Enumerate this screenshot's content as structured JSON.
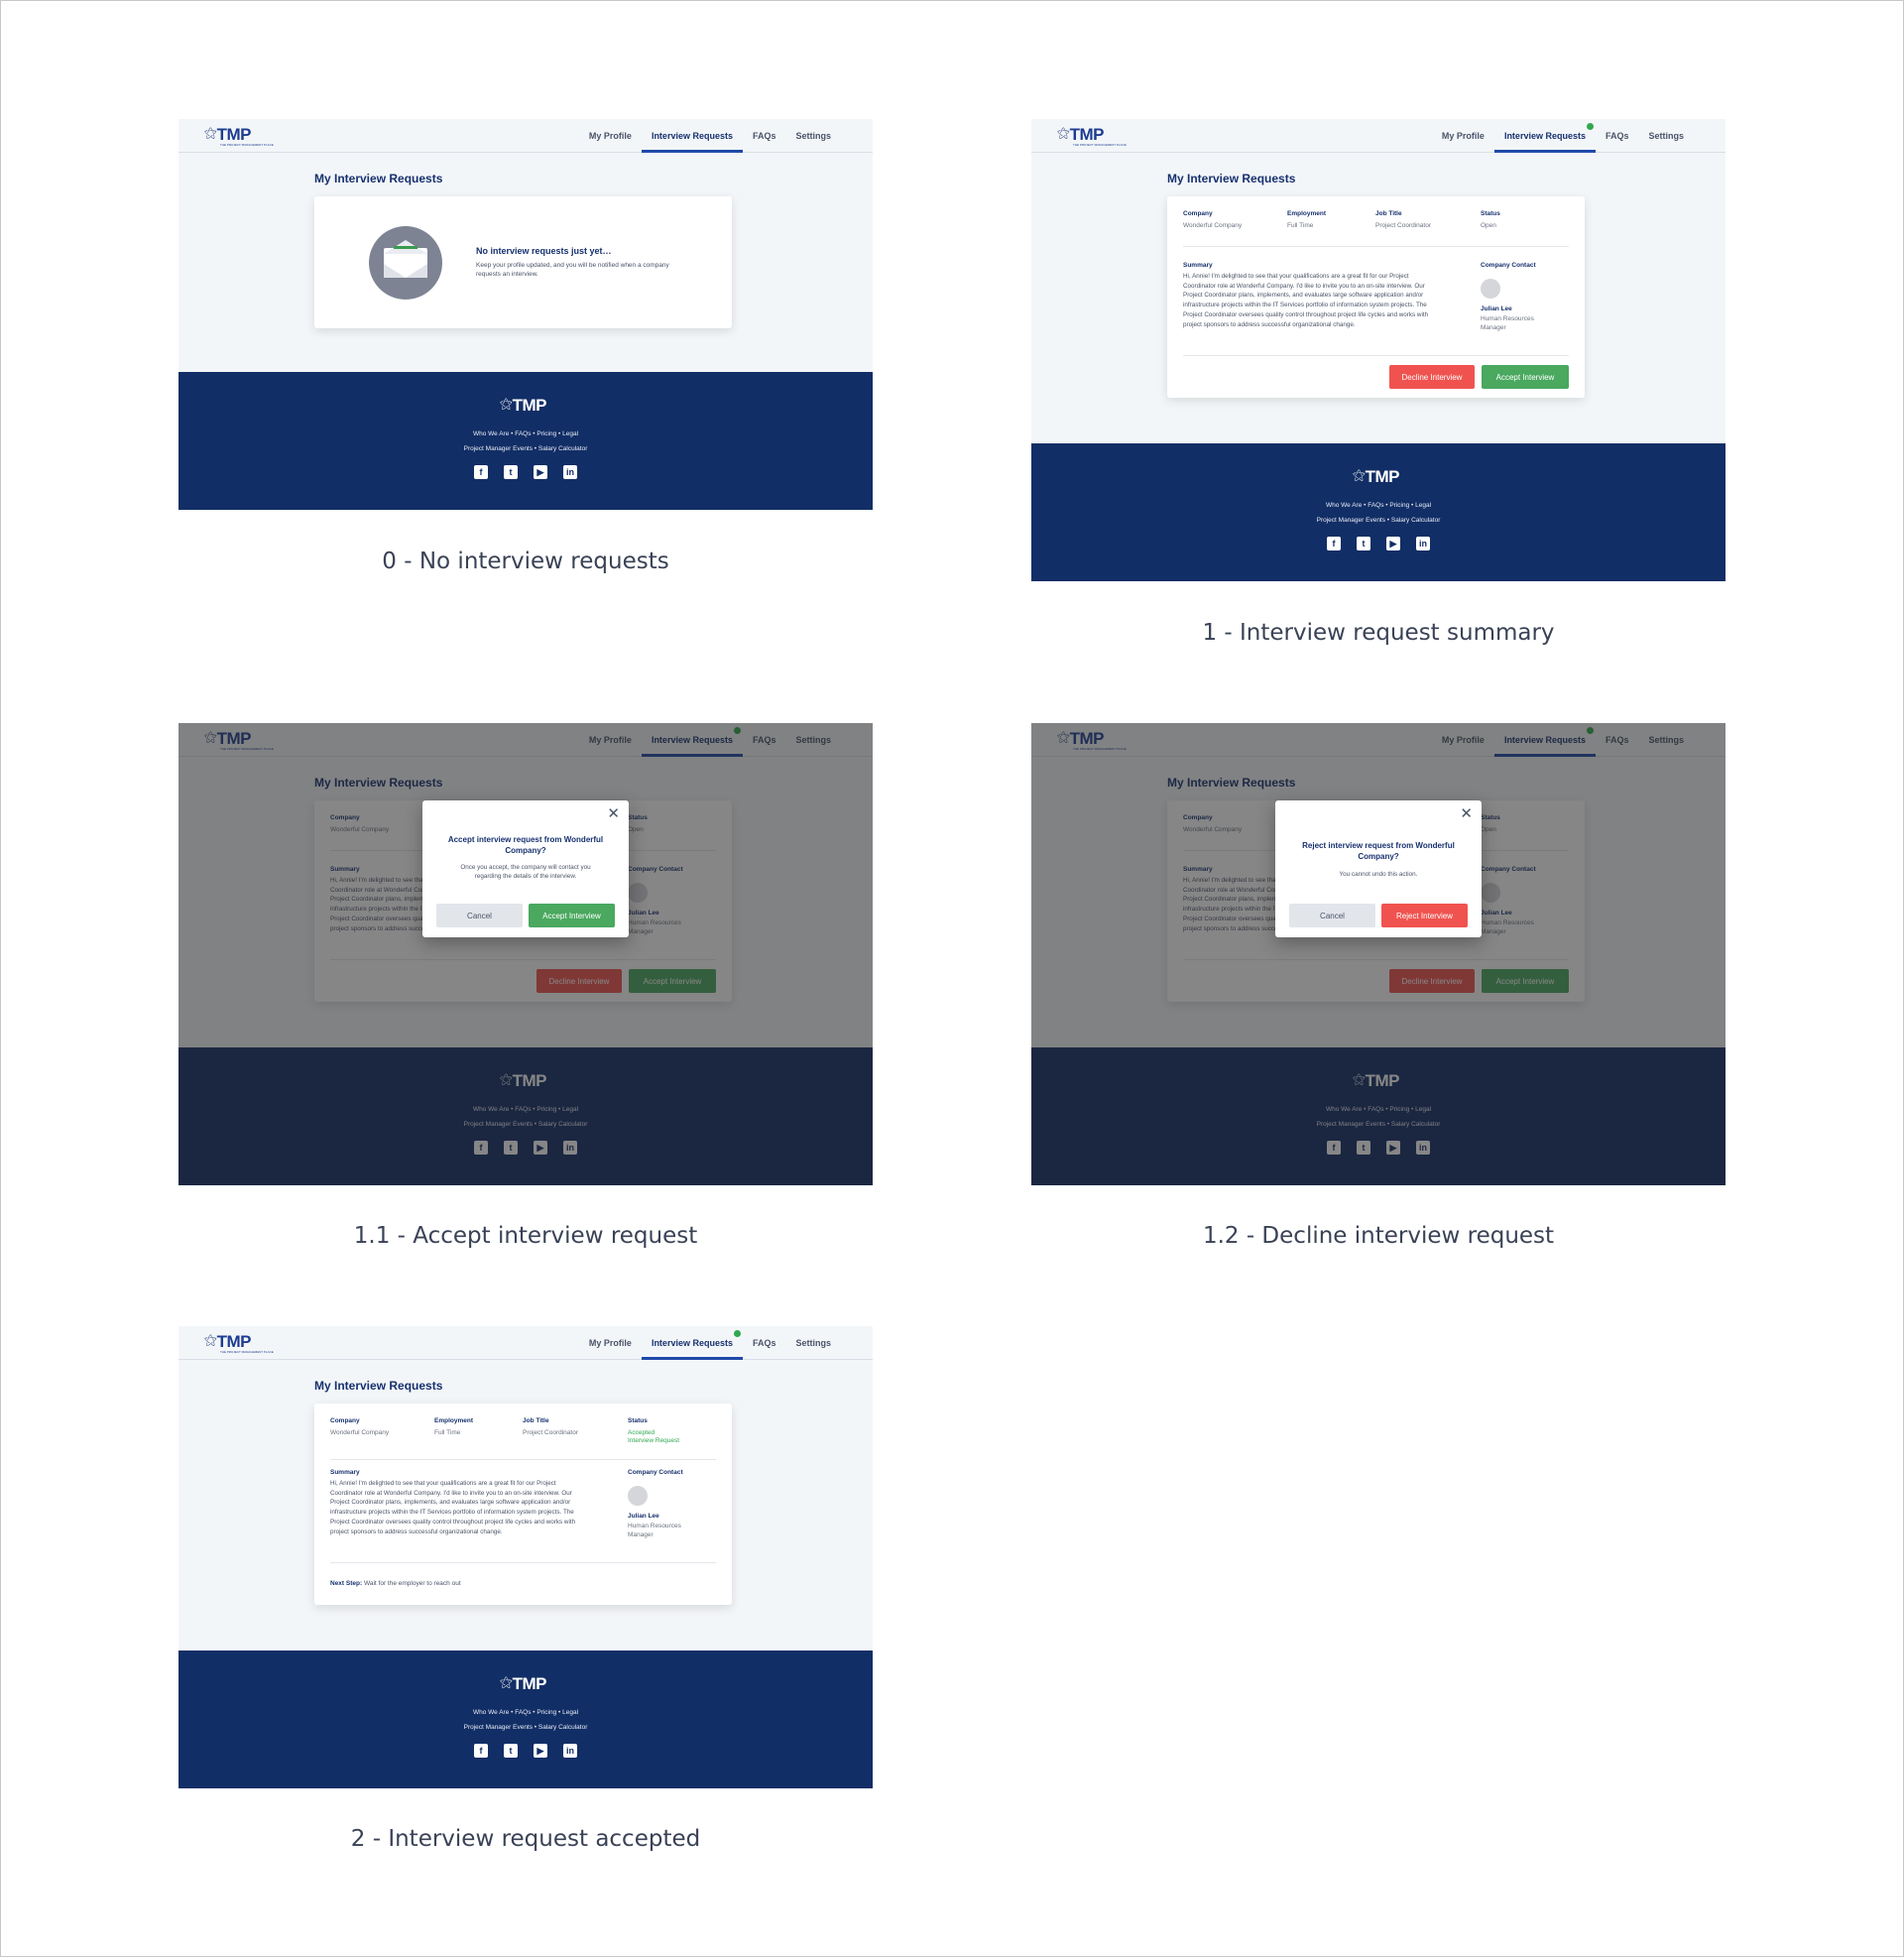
{
  "app": {
    "logo_text": "TMP",
    "logo_mark": "⚝",
    "logo_tagline": "THE PROJECT MANAGEMENT PLACE",
    "nav": [
      "My Profile",
      "Interview Requests",
      "FAQs",
      "Settings"
    ],
    "page_title": "My Interview Requests"
  },
  "empty_state": {
    "title": "No interview requests just yet…",
    "description": "Keep your profile updated, and you will be notified when a company requests an interview.",
    "icon": "envelope-icon"
  },
  "request": {
    "labels": {
      "company": "Company",
      "employment": "Employment",
      "job_title": "Job Title",
      "status": "Status",
      "summary": "Summary",
      "company_contact": "Company Contact"
    },
    "company": "Wonderful Company",
    "employment": "Full Time",
    "job_title": "Project Coordinator",
    "status_open": "Open",
    "status_accepted_1": "Accepted",
    "status_accepted_2": "Interview Request",
    "summary": "Hi, Annie! I'm delighted to see that your qualifications are a great fit for our Project Coordinator role at Wonderful Company. I'd like to invite you to an on-site interview. Our Project Coordinator plans, implements, and evaluates large software application and/or infrastructure projects within the IT Services portfolio of information system projects. The Project Coordinator oversees quality control throughout project life cycles and works with project sponsors to address successful organizational change.",
    "contact_name": "Julian Lee",
    "contact_role": "Human Resources Manager",
    "decline_label": "Decline Interview",
    "accept_label": "Accept Interview",
    "next_step_label": "Next Step:",
    "next_step_text": "Wait for the employer to reach out"
  },
  "accept_modal": {
    "title": "Accept interview request from Wonderful Company?",
    "description": "Once you accept, the company will contact you regarding the details of the interview.",
    "cancel_label": "Cancel",
    "confirm_label": "Accept Interview"
  },
  "reject_modal": {
    "title": "Reject interview request from Wonderful Company?",
    "description": "You cannot undo this action.",
    "cancel_label": "Cancel",
    "confirm_label": "Reject Interview"
  },
  "footer": {
    "links_line1": "Who We Are • FAQs • Pricing • Legal",
    "links_line2": "Project Manager Events • Salary Calculator",
    "social": [
      "facebook-icon",
      "twitter-icon",
      "youtube-icon",
      "linkedin-icon"
    ]
  },
  "captions": {
    "s0": "0 - No interview requests",
    "s1": "1 - Interview request summary",
    "s11": "1.1 - Accept interview request",
    "s12": "1.2 - Decline interview request",
    "s2": "2 - Interview request accepted"
  },
  "colors": {
    "primary": "#17316f",
    "footer_bg": "#122e66",
    "accept_green": "#4aa85f",
    "decline_red": "#f0534f",
    "page_bg": "#f3f6f9"
  }
}
